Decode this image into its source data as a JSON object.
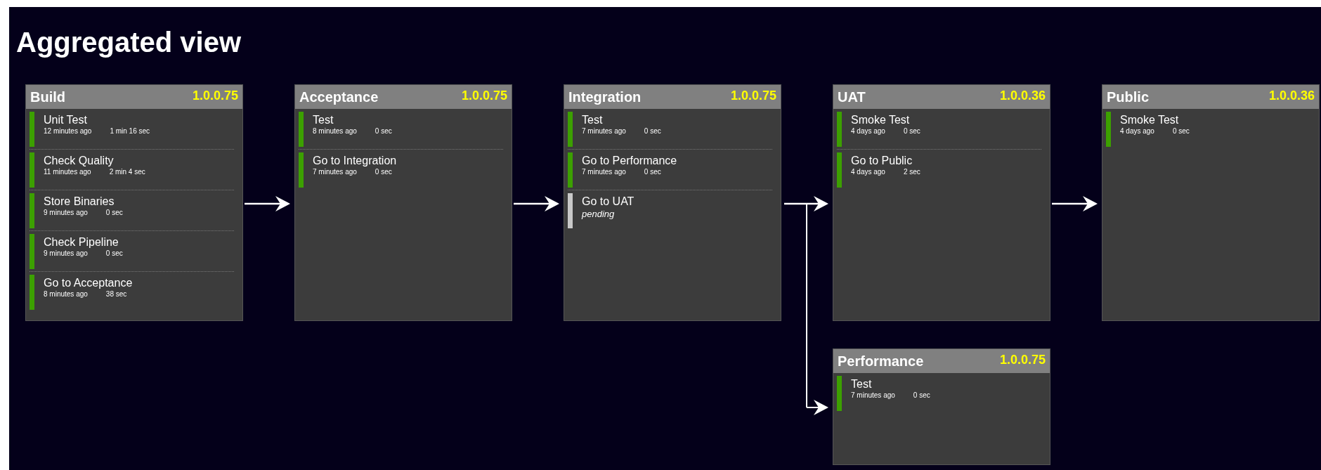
{
  "title": "Aggregated view",
  "stages": [
    {
      "name": "Build",
      "version": "1.0.0.75",
      "jobs": [
        {
          "name": "Unit Test",
          "kind": "passed",
          "time": "12 minutes ago",
          "duration": "1 min 16 sec"
        },
        {
          "name": "Check Quality",
          "kind": "passed",
          "time": "11 minutes ago",
          "duration": "2 min 4 sec"
        },
        {
          "name": "Store Binaries",
          "kind": "passed",
          "time": "9 minutes ago",
          "duration": "0 sec"
        },
        {
          "name": "Check Pipeline",
          "kind": "passed",
          "time": "9 minutes ago",
          "duration": "0 sec"
        },
        {
          "name": "Go to Acceptance",
          "kind": "passed",
          "time": "8 minutes ago",
          "duration": "38 sec"
        }
      ]
    },
    {
      "name": "Acceptance",
      "version": "1.0.0.75",
      "jobs": [
        {
          "name": "Test",
          "kind": "passed",
          "time": "8 minutes ago",
          "duration": "0 sec"
        },
        {
          "name": "Go to Integration",
          "kind": "passed",
          "time": "7 minutes ago",
          "duration": "0 sec"
        }
      ]
    },
    {
      "name": "Integration",
      "version": "1.0.0.75",
      "jobs": [
        {
          "name": "Test",
          "kind": "passed",
          "time": "7 minutes ago",
          "duration": "0 sec"
        },
        {
          "name": "Go to Performance",
          "kind": "passed",
          "time": "7 minutes ago",
          "duration": "0 sec"
        },
        {
          "name": "Go to UAT",
          "kind": "pending",
          "time": "pending"
        }
      ]
    },
    {
      "name": "UAT",
      "version": "1.0.0.36",
      "jobs": [
        {
          "name": "Smoke Test",
          "kind": "passed",
          "time": "4 days ago",
          "duration": "0 sec"
        },
        {
          "name": "Go to Public",
          "kind": "passed",
          "time": "4 days ago",
          "duration": "2 sec"
        }
      ]
    },
    {
      "name": "Public",
      "version": "1.0.0.36",
      "jobs": [
        {
          "name": "Smoke Test",
          "kind": "passed",
          "time": "4 days ago",
          "duration": "0 sec"
        }
      ]
    },
    {
      "name": "Performance",
      "version": "1.0.0.75",
      "jobs": [
        {
          "name": "Test",
          "kind": "passed",
          "time": "7 minutes ago",
          "duration": "0 sec"
        }
      ]
    }
  ]
}
